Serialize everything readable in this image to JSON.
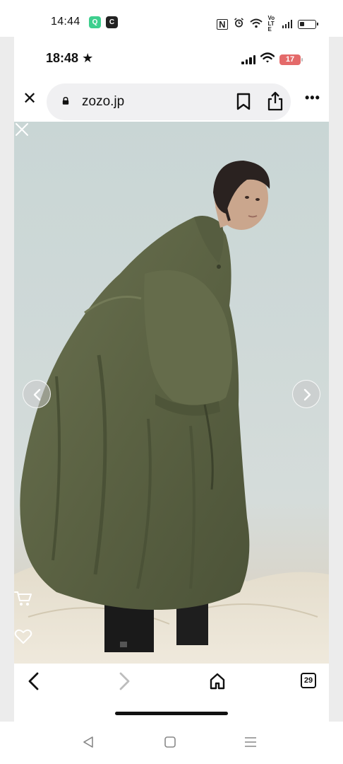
{
  "outer_status": {
    "time": "14:44",
    "badge_q": "Q",
    "badge_c": "C",
    "nfc_label": "N",
    "volte": "Vo LTE",
    "icons": [
      "nfc-icon",
      "alarm-icon",
      "wifi-icon",
      "volte-icon",
      "signal-icon",
      "battery-icon"
    ]
  },
  "ios_status": {
    "time": "18:48",
    "location_glyph": "★",
    "battery_level": "17",
    "icons": [
      "signal-icon",
      "wifi-icon",
      "battery-icon"
    ]
  },
  "browser": {
    "url": "zozo.jp",
    "close_glyph": "✕",
    "more_glyph": "•••",
    "tab_count": "29",
    "icons": [
      "close-icon",
      "lock-icon",
      "bookmark-icon",
      "share-icon",
      "more-icon",
      "back-icon",
      "forward-icon",
      "home-icon",
      "tabs-icon"
    ]
  },
  "gallery": {
    "icons": [
      "close-icon",
      "chevron-left-icon",
      "chevron-right-icon",
      "cart-icon",
      "heart-icon"
    ]
  },
  "colors": {
    "coat": "#5c6344",
    "background_wall": "#cbd7d6",
    "battery_badge": "#e46a6a",
    "accent_badge": "#3ecf8e"
  },
  "android_nav": {
    "icons": [
      "back-triangle-icon",
      "home-square-icon",
      "recents-menu-icon"
    ]
  }
}
